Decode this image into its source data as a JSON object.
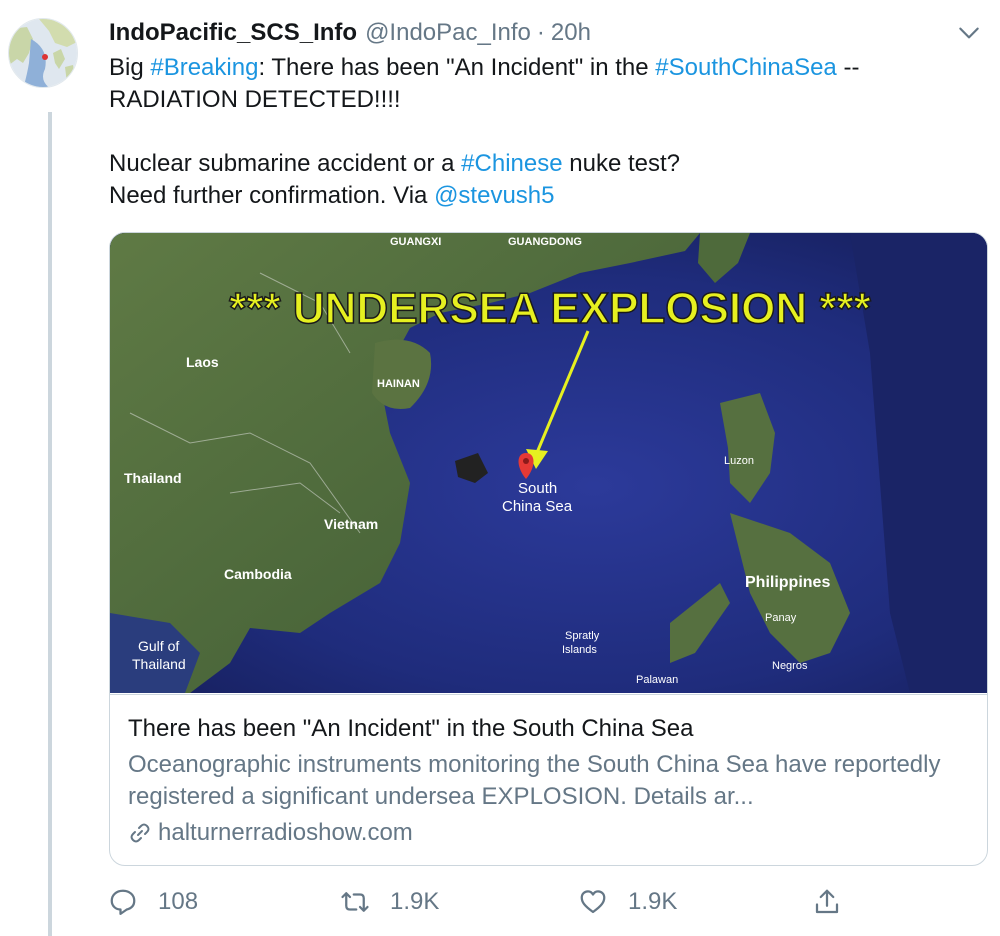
{
  "tweet": {
    "display_name": "IndoPacific_SCS_Info",
    "handle": "@IndoPac_Info",
    "dot": "·",
    "time": "20h",
    "text": {
      "p1_a": "Big ",
      "p1_tag1": "#Breaking",
      "p1_b": ": There has been \"An Incident\" in the ",
      "p1_tag2": "#SouthChinaSea",
      "p1_c": " --\nRADIATION DETECTED!!!!\n\nNuclear submarine accident or a ",
      "p2_tag": "#Chinese",
      "p2_a": " nuke test?\nNeed further confirmation. Via ",
      "p2_mention": "@stevush5"
    }
  },
  "card": {
    "image": {
      "banner": "*** UNDERSEA EXPLOSION ***",
      "labels": {
        "guangxi": "GUANGXI",
        "guangdong": "GUANGDONG",
        "laos": "Laos",
        "hainan": "HAINAN",
        "thailand": "Thailand",
        "vietnam": "Vietnam",
        "cambodia": "Cambodia",
        "gulf1": "Gulf of",
        "gulf2": "Thailand",
        "scs1": "South",
        "scs2": "China Sea",
        "luzon": "Luzon",
        "philippines": "Philippines",
        "panay": "Panay",
        "negros": "Negros",
        "spratly1": "Spratly",
        "spratly2": "Islands",
        "palawan": "Palawan"
      }
    },
    "title": "There has been \"An Incident\" in the South China Sea",
    "description": "Oceanographic instruments monitoring the South China Sea have reportedly registered a significant undersea EXPLOSION.  Details ar...",
    "domain": "halturnerradioshow.com"
  },
  "actions": {
    "replies": "108",
    "retweets": "1.9K",
    "likes": "1.9K"
  },
  "colors": {
    "link": "#1b95e0",
    "secondary_text": "#657786",
    "border": "#ccd6dd",
    "banner_yellow": "#e6f020"
  },
  "icons": [
    "chevron-down-icon",
    "link-icon",
    "reply-icon",
    "retweet-icon",
    "like-icon",
    "share-icon",
    "map-pin-icon"
  ]
}
